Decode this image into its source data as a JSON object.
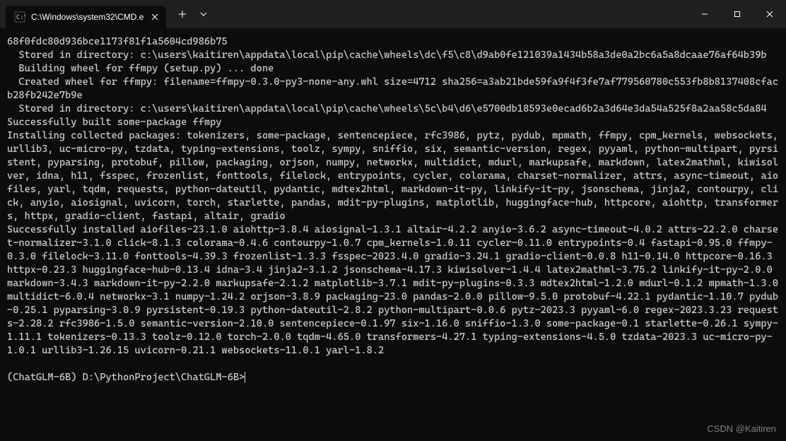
{
  "titlebar": {
    "tab_title": "C:\\Windows\\system32\\CMD.e"
  },
  "terminal": {
    "lines": [
      "68f0fdc80d936bce1173f81f1a5604cd986b75",
      "  Stored in directory: c:\\users\\kaitiren\\appdata\\local\\pip\\cache\\wheels\\dc\\f5\\c8\\d9ab0fe121039a1434b58a3de0a2bc6a5a8dcaae76af64b39b",
      "  Building wheel for ffmpy (setup.py) ... done",
      "  Created wheel for ffmpy: filename=ffmpy-0.3.0-py3-none-any.whl size=4712 sha256=a3ab21bde59fa9f4f3fe7af779560780c553fb8b8137408cfacb28fb242e7b9e",
      "  Stored in directory: c:\\users\\kaitiren\\appdata\\local\\pip\\cache\\wheels\\5c\\b4\\d6\\e5700db18593e0ecad6b2a3d64e3da54a525f8a2aa58c5da84",
      "Successfully built some-package ffmpy",
      "Installing collected packages: tokenizers, some-package, sentencepiece, rfc3986, pytz, pydub, mpmath, ffmpy, cpm_kernels, websockets, urllib3, uc-micro-py, tzdata, typing-extensions, toolz, sympy, sniffio, six, semantic-version, regex, pyyaml, python-multipart, pyrsistent, pyparsing, protobuf, pillow, packaging, orjson, numpy, networkx, multidict, mdurl, markupsafe, markdown, latex2mathml, kiwisolver, idna, h11, fsspec, frozenlist, fonttools, filelock, entrypoints, cycler, colorama, charset-normalizer, attrs, async-timeout, aiofiles, yarl, tqdm, requests, python-dateutil, pydantic, mdtex2html, markdown-it-py, linkify-it-py, jsonschema, jinja2, contourpy, click, anyio, aiosignal, uvicorn, torch, starlette, pandas, mdit-py-plugins, matplotlib, huggingface-hub, httpcore, aiohttp, transformers, httpx, gradio-client, fastapi, altair, gradio",
      "Successfully installed aiofiles-23.1.0 aiohttp-3.8.4 aiosignal-1.3.1 altair-4.2.2 anyio-3.6.2 async-timeout-4.0.2 attrs-22.2.0 charset-normalizer-3.1.0 click-8.1.3 colorama-0.4.6 contourpy-1.0.7 cpm_kernels-1.0.11 cycler-0.11.0 entrypoints-0.4 fastapi-0.95.0 ffmpy-0.3.0 filelock-3.11.0 fonttools-4.39.3 frozenlist-1.3.3 fsspec-2023.4.0 gradio-3.24.1 gradio-client-0.0.8 h11-0.14.0 httpcore-0.16.3 httpx-0.23.3 huggingface-hub-0.13.4 idna-3.4 jinja2-3.1.2 jsonschema-4.17.3 kiwisolver-1.4.4 latex2mathml-3.75.2 linkify-it-py-2.0.0 markdown-3.4.3 markdown-it-py-2.2.0 markupsafe-2.1.2 matplotlib-3.7.1 mdit-py-plugins-0.3.3 mdtex2html-1.2.0 mdurl-0.1.2 mpmath-1.3.0 multidict-6.0.4 networkx-3.1 numpy-1.24.2 orjson-3.8.9 packaging-23.0 pandas-2.0.0 pillow-9.5.0 protobuf-4.22.1 pydantic-1.10.7 pydub-0.25.1 pyparsing-3.0.9 pyrsistent-0.19.3 python-dateutil-2.8.2 python-multipart-0.0.6 pytz-2023.3 pyyaml-6.0 regex-2023.3.23 requests-2.28.2 rfc3986-1.5.0 semantic-version-2.10.0 sentencepiece-0.1.97 six-1.16.0 sniffio-1.3.0 some-package-0.1 starlette-0.26.1 sympy-1.11.1 tokenizers-0.13.3 toolz-0.12.0 torch-2.0.0 tqdm-4.65.0 transformers-4.27.1 typing-extensions-4.5.0 tzdata-2023.3 uc-micro-py-1.0.1 urllib3-1.26.15 uvicorn-0.21.1 websockets-11.0.1 yarl-1.8.2",
      ""
    ],
    "prompt": "(ChatGLM-6B) D:\\PythonProject\\ChatGLM-6B>"
  },
  "watermark": "CSDN @Kaitiren"
}
